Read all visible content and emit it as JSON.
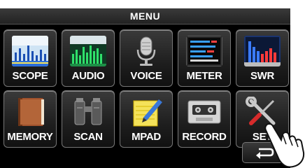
{
  "header": {
    "title": "MENU"
  },
  "tiles": [
    {
      "label": "SCOPE",
      "icon": "scope-icon"
    },
    {
      "label": "AUDIO",
      "icon": "audio-icon"
    },
    {
      "label": "VOICE",
      "icon": "microphone-icon"
    },
    {
      "label": "METER",
      "icon": "meter-icon"
    },
    {
      "label": "SWR",
      "icon": "swr-chart-icon"
    },
    {
      "label": "MEMORY",
      "icon": "memory-book-icon"
    },
    {
      "label": "SCAN",
      "icon": "binoculars-icon"
    },
    {
      "label": "MPAD",
      "icon": "notepad-pencil-icon"
    },
    {
      "label": "RECORD",
      "icon": "cassette-icon"
    },
    {
      "label": "SET",
      "icon": "wrench-screwdriver-icon"
    }
  ],
  "back_button": {
    "icon": "return-arrow-icon"
  },
  "colors": {
    "screen_bg": "#000000",
    "tile_border": "#777777",
    "label": "#ffffff"
  }
}
